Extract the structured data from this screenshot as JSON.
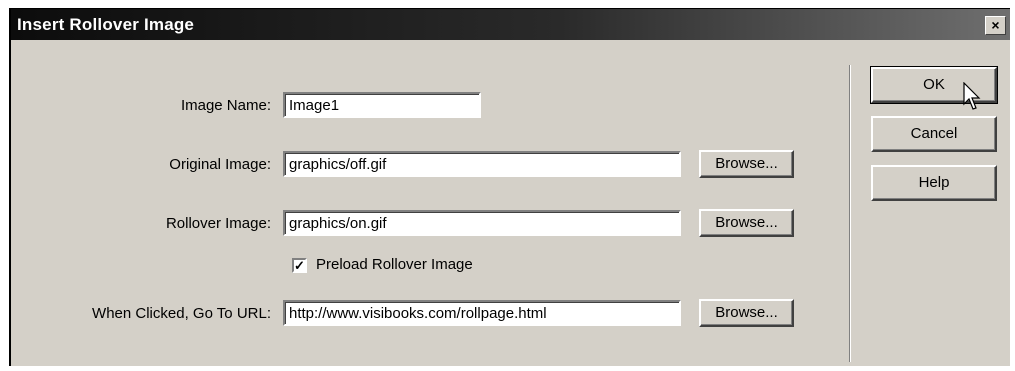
{
  "window": {
    "title": "Insert Rollover Image",
    "close_glyph": "×"
  },
  "form": {
    "image_name": {
      "label": "Image Name:",
      "value": "Image1"
    },
    "original_image": {
      "label": "Original Image:",
      "value": "graphics/off.gif",
      "browse": "Browse..."
    },
    "rollover_image": {
      "label": "Rollover Image:",
      "value": "graphics/on.gif",
      "browse": "Browse..."
    },
    "preload": {
      "label": "Preload Rollover Image",
      "checked": true,
      "check_glyph": "✓"
    },
    "url": {
      "label": "When Clicked, Go To URL:",
      "value": "http://www.visibooks.com/rollpage.html",
      "browse": "Browse..."
    }
  },
  "buttons": {
    "ok": "OK",
    "cancel": "Cancel",
    "help": "Help"
  }
}
